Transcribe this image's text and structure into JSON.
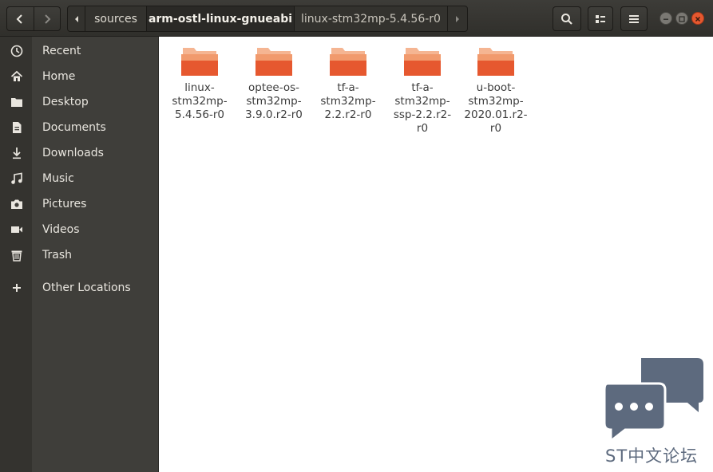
{
  "headerbar": {
    "back_icon": "chevron-left-icon",
    "forward_icon": "chevron-right-icon",
    "breadcrumb": [
      "sources",
      "arm-ostl-linux-gnueabi",
      "linux-stm32mp-5.4.56-r0"
    ],
    "search_icon": "search-icon",
    "view_icon": "view-options-icon",
    "menu_icon": "hamburger-menu-icon"
  },
  "sidebar": {
    "items": [
      {
        "label": "Recent",
        "icon": "clock-icon"
      },
      {
        "label": "Home",
        "icon": "home-icon"
      },
      {
        "label": "Desktop",
        "icon": "folder-icon"
      },
      {
        "label": "Documents",
        "icon": "document-icon"
      },
      {
        "label": "Downloads",
        "icon": "download-icon"
      },
      {
        "label": "Music",
        "icon": "music-icon"
      },
      {
        "label": "Pictures",
        "icon": "camera-icon"
      },
      {
        "label": "Videos",
        "icon": "video-icon"
      },
      {
        "label": "Trash",
        "icon": "trash-icon"
      },
      {
        "label": "Other Locations",
        "icon": "plus-icon"
      }
    ]
  },
  "files": [
    {
      "lines": [
        "linux-",
        "stm32mp-",
        "5.4.56-r0"
      ]
    },
    {
      "lines": [
        "optee-os-",
        "stm32mp-",
        "3.9.0.r2-r0"
      ]
    },
    {
      "lines": [
        "tf-a-",
        "stm32mp-",
        "2.2.r2-r0"
      ]
    },
    {
      "lines": [
        "tf-a-",
        "stm32mp-",
        "ssp-2.2.r2-",
        "r0"
      ]
    },
    {
      "lines": [
        "u-boot-",
        "stm32mp-",
        "2020.01.r2-",
        "r0"
      ]
    }
  ],
  "watermark": {
    "text": "ST中文论坛",
    "colors": {
      "bubble": "#5d6a7e"
    }
  },
  "colors": {
    "folder_top": "#f19a6d",
    "folder_body": "#e6582f",
    "close_button": "#e6582f"
  }
}
